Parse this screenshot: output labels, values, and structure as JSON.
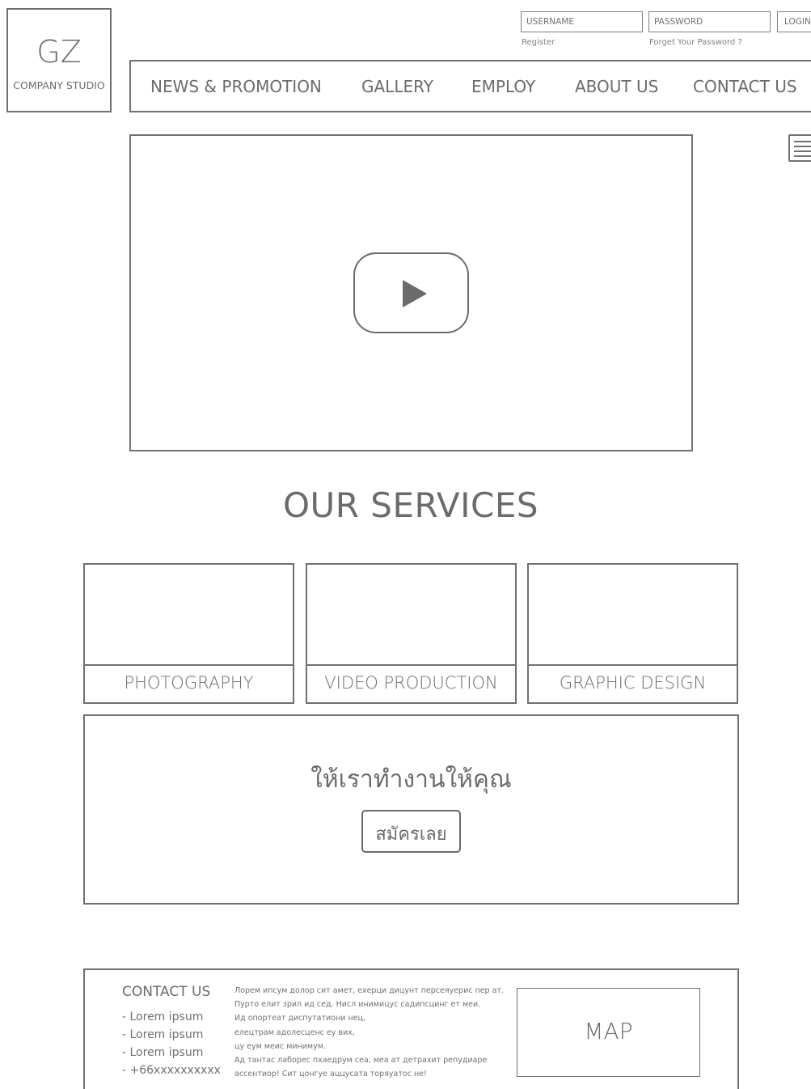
{
  "brand": {
    "mark": "GZ",
    "name": "COMPANY STUDIO"
  },
  "login": {
    "username_placeholder": "USERNAME",
    "password_placeholder": "PASSWORD",
    "login_label": "LOGIN",
    "register_label": "Register",
    "forgot_label": "Forget Your Password ?"
  },
  "nav": {
    "items": [
      {
        "label": "NEWS & PROMOTION"
      },
      {
        "label": "GALLERY"
      },
      {
        "label": "EMPLOY"
      },
      {
        "label": "ABOUT US"
      },
      {
        "label": "CONTACT US"
      }
    ]
  },
  "icons": {
    "menu": "hamburger-menu-icon",
    "play": "play-icon"
  },
  "services": {
    "title": "OUR SERVICES",
    "items": [
      {
        "label": "PHOTOGRAPHY"
      },
      {
        "label": "VIDEO PRODUCTION"
      },
      {
        "label": "GRAPHIC DESIGN"
      }
    ]
  },
  "cta": {
    "text": "ให้เราทำงานให้คุณ",
    "button_label": "สมัครเลย"
  },
  "footer": {
    "contact_title": "CONTACT US",
    "links": [
      {
        "label": "- Lorem ipsum"
      },
      {
        "label": "- Lorem ipsum"
      },
      {
        "label": "- Lorem ipsum"
      },
      {
        "label": "- +66xxxxxxxxxx"
      }
    ],
    "text_lines": [
      "Лорем ипсум долор сит амет, ехерци дицунт персеяуерис пер ат.",
      "Пурто елит зрил ид сед. Нисл инимицус садипсцинг ет меи.",
      "Ид опортеат диспутатиони нец,",
      "елецтрам адолесценс еу вих,",
      "цу еум меис минимум.",
      "Ад тантас лаборес пхаедрум сеа, меа ат детрахит репудиаре",
      "ассентиор! Сит цонгуе аццусата торяуатос не!"
    ],
    "map_label": "MAP"
  },
  "colors": {
    "line": "#707070",
    "text": "#6b6b6b",
    "background": "#ffffff"
  }
}
